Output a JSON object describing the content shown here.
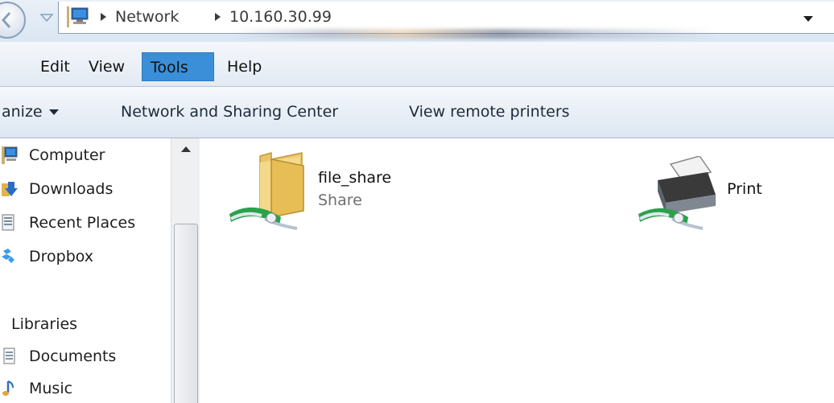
{
  "address": {
    "crumbs": [
      "Network",
      "10.160.30.99"
    ]
  },
  "menu": {
    "items": [
      {
        "label": "Edit",
        "active": false
      },
      {
        "label": "View",
        "active": false
      },
      {
        "label": "Tools",
        "active": true
      },
      {
        "label": "Help",
        "active": false
      }
    ]
  },
  "commands": {
    "organize": "anize",
    "network_sharing": "Network and Sharing Center",
    "remote_printers": "View remote printers"
  },
  "nav": {
    "items": [
      {
        "label": "Computer",
        "icon": "computer-icon"
      },
      {
        "label": "Downloads",
        "icon": "downloads-icon"
      },
      {
        "label": "Recent Places",
        "icon": "recent-places-icon"
      },
      {
        "label": "Dropbox",
        "icon": "dropbox-icon"
      }
    ],
    "libraries_header": "Libraries",
    "library_items": [
      {
        "label": "Documents",
        "icon": "documents-icon"
      },
      {
        "label": "Music",
        "icon": "music-icon"
      }
    ]
  },
  "content": {
    "items": [
      {
        "name": "file_share",
        "subtitle": "Share",
        "icon": "shared-folder-icon"
      },
      {
        "name": "Print",
        "subtitle": "",
        "icon": "shared-printer-icon"
      }
    ]
  }
}
